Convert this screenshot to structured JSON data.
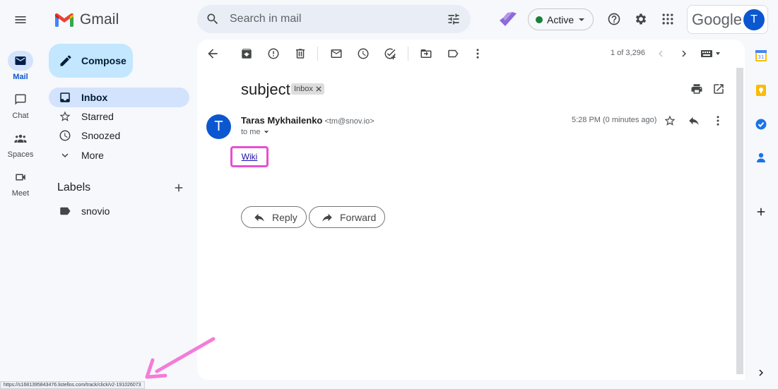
{
  "app": {
    "name": "Gmail"
  },
  "search": {
    "placeholder": "Search in mail"
  },
  "status": {
    "label": "Active"
  },
  "account": {
    "brand": "Google",
    "avatar_letter": "T"
  },
  "rail": [
    {
      "label": "Mail"
    },
    {
      "label": "Chat"
    },
    {
      "label": "Spaces"
    },
    {
      "label": "Meet"
    }
  ],
  "sidebar": {
    "compose_label": "Compose",
    "items": [
      {
        "label": "Inbox"
      },
      {
        "label": "Starred"
      },
      {
        "label": "Snoozed"
      },
      {
        "label": "More"
      }
    ],
    "labels_title": "Labels",
    "labels": [
      {
        "label": "snovio"
      }
    ]
  },
  "toolbar": {
    "pager": "1 of 3,296"
  },
  "message": {
    "subject": "subject",
    "chip": "Inbox",
    "sender_initial": "T",
    "sender_name": "Taras Mykhailenko",
    "sender_email": "<tm@snov.io>",
    "to": "to me",
    "time": "5:28 PM (0 minutes ago)",
    "body_link": "Wiki"
  },
  "actions": {
    "reply": "Reply",
    "forward": "Forward"
  },
  "status_bar": {
    "url": "https://s1681395843476.listellos.com/track/click/v2-191026073"
  },
  "colors": {
    "accent": "#0b57d0",
    "highlight": "#e84fd0",
    "compose": "#c2e7ff",
    "active_dot": "#188038"
  }
}
